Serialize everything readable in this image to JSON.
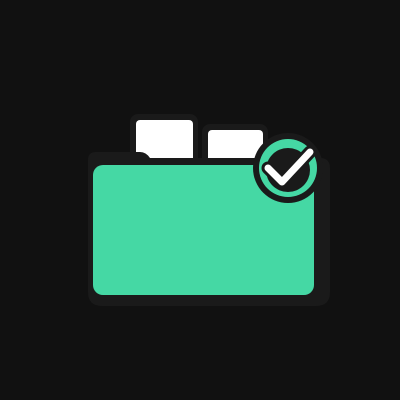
{
  "illustration": {
    "icon": "folder-with-documents-checked-icon",
    "colors": {
      "background": "#111111",
      "outline": "#1a1a1a",
      "folder": "#45d8a4",
      "document": "#ffffff",
      "badge": "#45d8a4",
      "check": "#ffffff"
    }
  }
}
